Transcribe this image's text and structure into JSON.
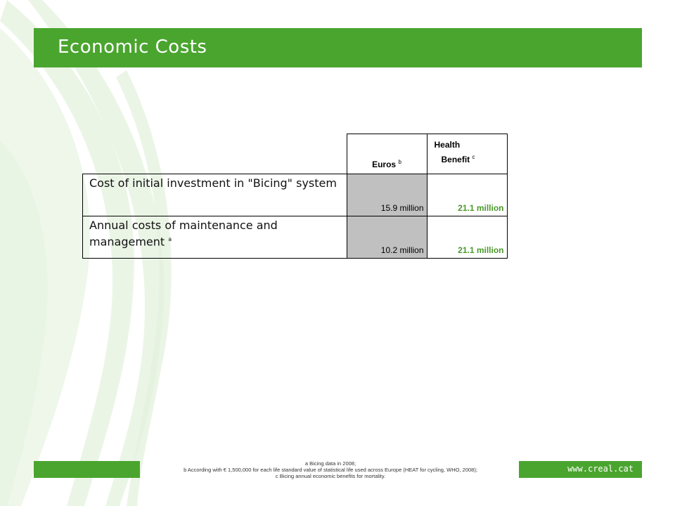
{
  "slide": {
    "title": "Economic Costs",
    "url": "www.creal.cat"
  },
  "table": {
    "headers": {
      "euros": "Euros",
      "euros_note": "b",
      "health_line1": "Health",
      "health_line2": "Benefit",
      "health_note": "c"
    },
    "rows": [
      {
        "label": "Cost of initial investment in \"Bicing\" system",
        "note": "",
        "euros": "15.9 million",
        "benefit": "21.1 million"
      },
      {
        "label": "Annual costs of maintenance and management",
        "note": "a",
        "euros": "10.2 million",
        "benefit": "21.1 million"
      }
    ]
  },
  "footnotes": {
    "a": "a Bicing data in 2008;",
    "b": "b According with € 1,500,000 for each life standard value of statistical life used across Europe (HEAT for cycling, WHO, 2008);",
    "c": "c Bicing annual economic benefits for mortality."
  },
  "colors": {
    "brand_green": "#4aa52e",
    "benefit_text": "#4a9a2a",
    "euro_cell_bg": "#c0c0c0"
  }
}
